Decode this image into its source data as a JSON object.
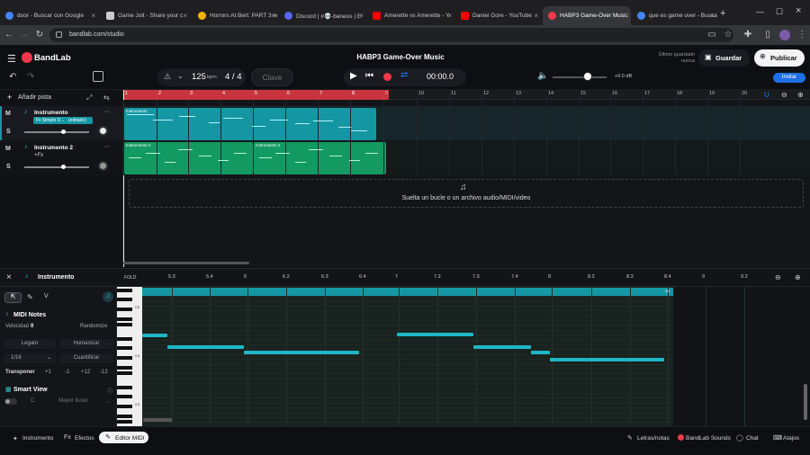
{
  "browser": {
    "tabs": [
      {
        "title": "door - Buscar con Google",
        "color": "#4285f4"
      },
      {
        "title": "Game Jolt - Share your c",
        "color": "#cccccc"
      },
      {
        "title": "Horrors At Bert: PART 3 w",
        "color": "#f4b400"
      },
      {
        "title": "Discord | #💀-baneos | E",
        "color": "#5865f2"
      },
      {
        "title": "Amerette vs Amerette - Y",
        "color": "#ff0000"
      },
      {
        "title": "Daniel Gore - YouTube",
        "color": "#ff0000"
      },
      {
        "title": "HABP3 Game-Over Music",
        "color": "#f2384a"
      },
      {
        "title": "que es game over - Busca",
        "color": "#4285f4"
      }
    ],
    "new_tab": "+",
    "url": "bandlab.com/studio"
  },
  "header": {
    "logo": "BandLab",
    "tempo": "125",
    "tempo_unit": "bpm",
    "time_sig": "4 / 4",
    "key": "Clave",
    "project_title": "HABP3 Game-Over Music",
    "time": "00:00.0",
    "volume_db": "+0.0 dB",
    "last_saved_label": "Último guardado",
    "last_saved_value": "nunca",
    "save": "Guardar",
    "publish": "Publicar",
    "invite": "Invitar"
  },
  "tracks": {
    "add_track": "Añadir pista",
    "items": [
      {
        "name": "Instrumento",
        "fx": "Fx Simple D...",
        "badge": "(editado)",
        "m": "M",
        "s": "S"
      },
      {
        "name": "Instrumento 2",
        "fx": "+Fx",
        "m": "M",
        "s": "S"
      }
    ]
  },
  "timeline": {
    "ruler": [
      "1",
      "2",
      "3",
      "4",
      "5",
      "6",
      "7",
      "8",
      "9",
      "10",
      "11",
      "12",
      "13",
      "14",
      "15",
      "16",
      "17",
      "18",
      "19",
      "20"
    ],
    "clips": [
      {
        "label": "Instrumento",
        "color": "#1597a3"
      },
      {
        "label": "Instrumento 2",
        "color": "#139a63"
      },
      {
        "label": "Instrumento 2",
        "color": "#139a63"
      }
    ],
    "drop_text": "Suelta un bucle o un archivo audio/MIDI/video"
  },
  "editor": {
    "track_name": "Instrumento",
    "fold": "FOLD",
    "ruler": [
      "5.3",
      "5.4",
      "6",
      "6.2",
      "6.3",
      "6.4",
      "7",
      "7.2",
      "7.3",
      "7.4",
      "8",
      "8.2",
      "8.3",
      "8.4",
      "9",
      "9.2"
    ],
    "midi_notes": "MIDI Notes",
    "velocity_label": "Velocidad",
    "velocity_value": "0",
    "randomize": "Randomize",
    "legato": "Legato",
    "humanize": "Humanizar",
    "grid": "1/16",
    "quantize": "Cuantificar",
    "transpose": "Transponer",
    "transpose_buttons": [
      "+1",
      "-1",
      "+12",
      "-12"
    ],
    "smart_view": "Smart View",
    "key_c": "C",
    "scale": "Mayor Ilusio",
    "piano_labels": [
      "C5",
      "C4",
      "C3"
    ]
  },
  "bottom": {
    "instrument": "Instrumento",
    "effects": "Efectos",
    "midi_editor": "Editor MIDI",
    "lyrics": "Letras/notas",
    "sounds": "BandLab Sounds",
    "chat": "Chat",
    "shortcuts": "Atajos"
  },
  "colors": {
    "accent": "#f2384a",
    "invite": "#1e6fe6",
    "midi": "#1fb6c7"
  }
}
